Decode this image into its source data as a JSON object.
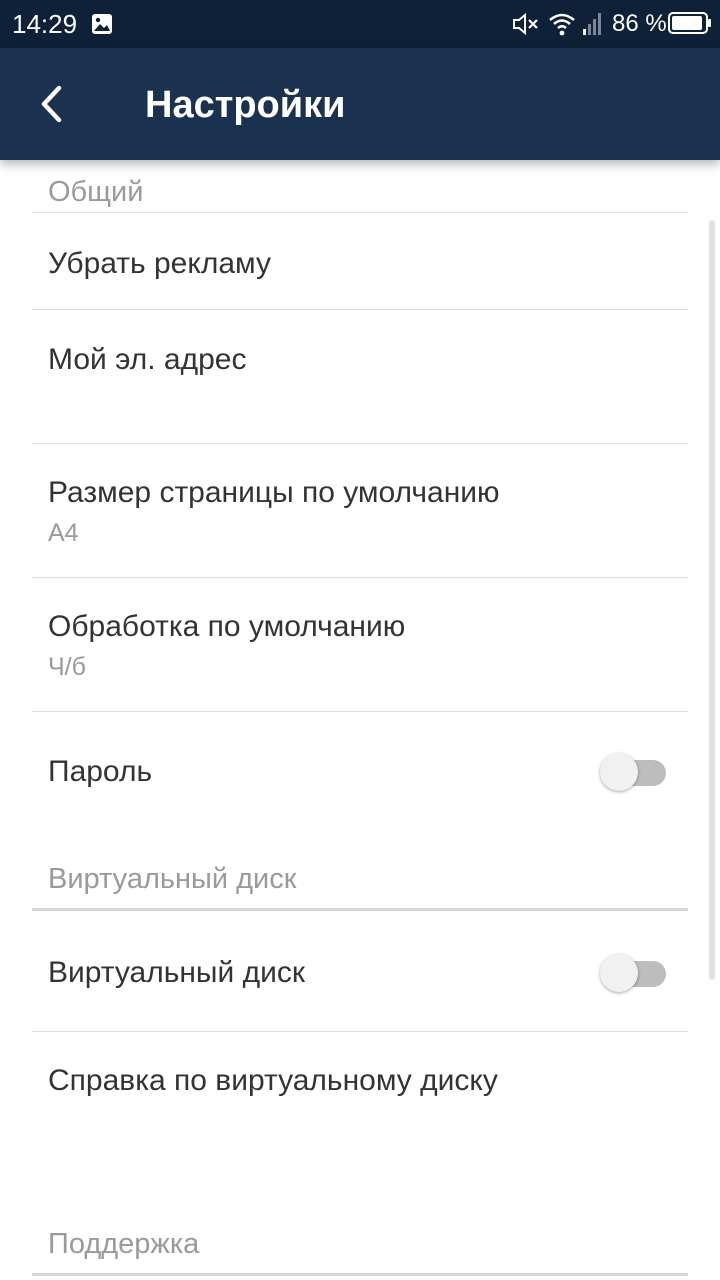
{
  "status_bar": {
    "time": "14:29",
    "battery_text": "86 %",
    "icons": [
      "gallery-icon",
      "mute-icon",
      "wifi-icon",
      "signal-icon",
      "battery-icon"
    ]
  },
  "app_bar": {
    "title": "Настройки",
    "back_icon": "back-arrow-icon",
    "background_color": "#1a314f"
  },
  "sections": {
    "general": {
      "header": "Общий",
      "items": {
        "remove_ads": {
          "title": "Убрать рекламу"
        },
        "my_email": {
          "title": "Мой эл. адрес"
        },
        "page_size": {
          "title": "Размер страницы по умолчанию",
          "summary": "A4"
        },
        "processing": {
          "title": "Обработка по умолчанию",
          "summary": "Ч/б"
        },
        "password": {
          "title": "Пароль",
          "switch_on": false
        }
      }
    },
    "virtual_disk": {
      "header": "Виртуальный диск",
      "items": {
        "virtual_disk": {
          "title": "Виртуальный диск",
          "switch_on": false
        },
        "help": {
          "title": "Справка по виртуальному диску"
        }
      }
    },
    "support": {
      "header": "Поддержка"
    }
  }
}
